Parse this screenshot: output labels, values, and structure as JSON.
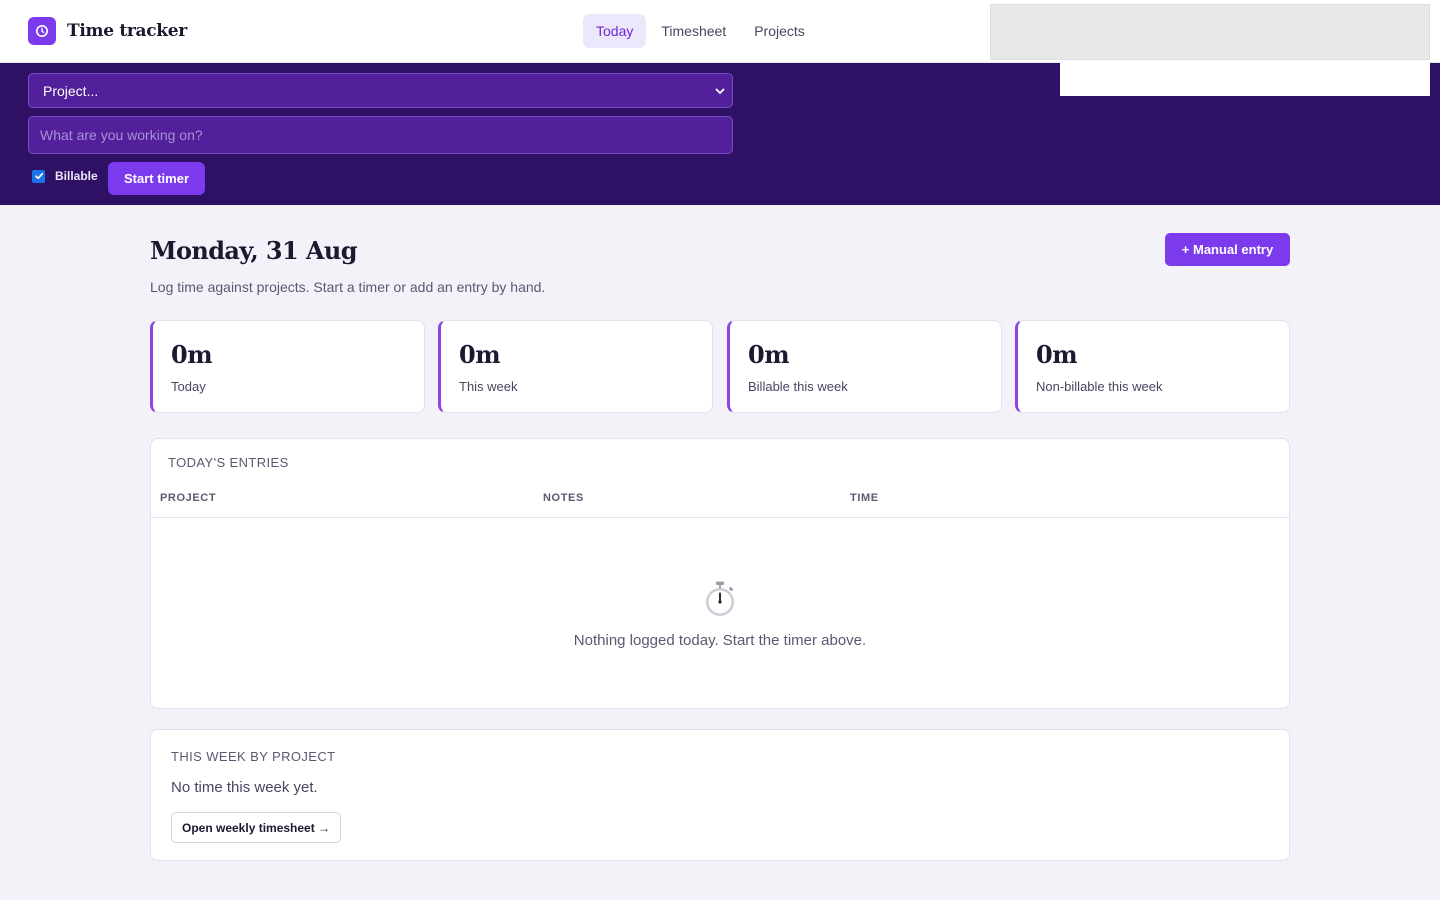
{
  "header": {
    "app_title": "Time tracker",
    "nav": [
      {
        "label": "Today",
        "active": true
      },
      {
        "label": "Timesheet",
        "active": false
      },
      {
        "label": "Projects",
        "active": false
      }
    ],
    "logo_icon": "clock-icon"
  },
  "timer": {
    "project_select_value": "Project...",
    "task_placeholder": "What are you working on?",
    "billable_label": "Billable",
    "billable_checked": true,
    "start_label": "Start timer"
  },
  "main": {
    "title": "Monday, 31 Aug",
    "subtitle": "Log time against projects. Start a timer or add an entry by hand.",
    "manual_entry_label": "+ Manual entry",
    "stats": [
      {
        "value": "0m",
        "label": "Today"
      },
      {
        "value": "0m",
        "label": "This week"
      },
      {
        "value": "0m",
        "label": "Billable this week"
      },
      {
        "value": "0m",
        "label": "Non-billable this week"
      }
    ],
    "entries": {
      "heading": "TODAY'S ENTRIES",
      "columns": [
        "PROJECT",
        "NOTES",
        "TIME"
      ],
      "empty_text": "Nothing logged today. Start the timer above.",
      "empty_icon": "stopwatch-icon"
    },
    "week": {
      "heading": "THIS WEEK BY PROJECT",
      "empty_text": "No time this week yet.",
      "button_label": "Open weekly timesheet →"
    }
  },
  "colors": {
    "accent": "#7c3aed",
    "timer_bar": "#2e1165",
    "page_bg": "#f4f2f9"
  }
}
